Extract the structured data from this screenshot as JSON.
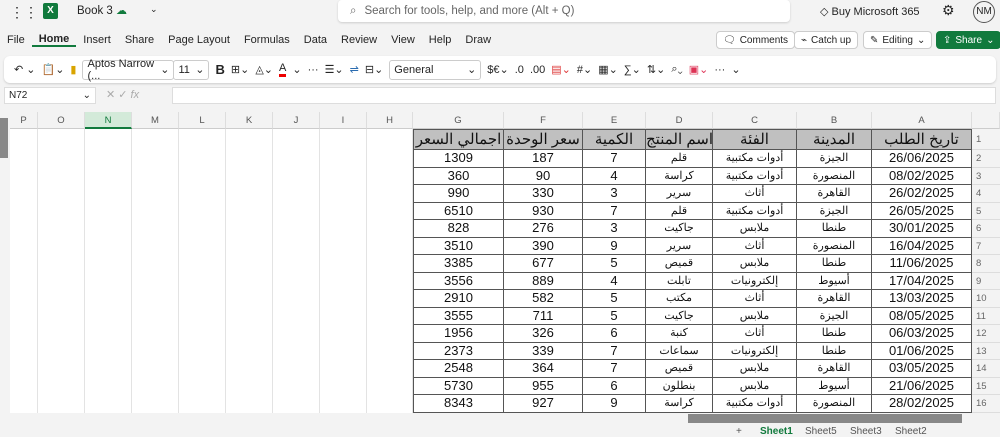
{
  "app": {
    "title": "Book 3",
    "search_placeholder": "Search for tools, help, and more (Alt + Q)",
    "buy": "Buy Microsoft 365",
    "avatar": "NM"
  },
  "menu": [
    "File",
    "Home",
    "Insert",
    "Share",
    "Page Layout",
    "Formulas",
    "Data",
    "Review",
    "View",
    "Help",
    "Draw"
  ],
  "ribbon_buttons": {
    "comments": "Comments",
    "catchup": "Catch up",
    "editing": "Editing",
    "share": "Share"
  },
  "toolbar": {
    "font": "Aptos Narrow (...",
    "size": "11",
    "format": "General",
    "bold": "B"
  },
  "namebox": "N72",
  "columns": [
    "P",
    "O",
    "N",
    "M",
    "L",
    "K",
    "J",
    "I",
    "H",
    "G",
    "F",
    "E",
    "D",
    "C",
    "B",
    "A"
  ],
  "selected_column": "N",
  "table": {
    "headers": [
      "تاريخ الطلب",
      "المدينة",
      "الفئة",
      "اسم المنتج",
      "الكمية",
      "سعر الوحدة",
      "اجمالي السعر"
    ],
    "rows": [
      [
        "26/06/2025",
        "الجيزة",
        "أدوات مكتبية",
        "قلم",
        "7",
        "187",
        "1309"
      ],
      [
        "08/02/2025",
        "المنصورة",
        "أدوات مكتبية",
        "كراسة",
        "4",
        "90",
        "360"
      ],
      [
        "26/02/2025",
        "القاهرة",
        "أثاث",
        "سرير",
        "3",
        "330",
        "990"
      ],
      [
        "26/05/2025",
        "الجيزة",
        "أدوات مكتبية",
        "قلم",
        "7",
        "930",
        "6510"
      ],
      [
        "30/01/2025",
        "طنطا",
        "ملابس",
        "جاكيت",
        "3",
        "276",
        "828"
      ],
      [
        "16/04/2025",
        "المنصورة",
        "أثاث",
        "سرير",
        "9",
        "390",
        "3510"
      ],
      [
        "11/06/2025",
        "طنطا",
        "ملابس",
        "قميص",
        "5",
        "677",
        "3385"
      ],
      [
        "17/04/2025",
        "أسيوط",
        "إلكترونيات",
        "تابلت",
        "4",
        "889",
        "3556"
      ],
      [
        "13/03/2025",
        "القاهرة",
        "أثاث",
        "مكتب",
        "5",
        "582",
        "2910"
      ],
      [
        "08/05/2025",
        "الجيزة",
        "ملابس",
        "جاكيت",
        "5",
        "711",
        "3555"
      ],
      [
        "06/03/2025",
        "طنطا",
        "أثاث",
        "كنبة",
        "6",
        "326",
        "1956"
      ],
      [
        "01/06/2025",
        "طنطا",
        "إلكترونيات",
        "سماعات",
        "7",
        "339",
        "2373"
      ],
      [
        "03/05/2025",
        "القاهرة",
        "ملابس",
        "قميص",
        "7",
        "364",
        "2548"
      ],
      [
        "21/06/2025",
        "أسيوط",
        "ملابس",
        "بنطلون",
        "6",
        "955",
        "5730"
      ],
      [
        "28/02/2025",
        "المنصورة",
        "أدوات مكتبية",
        "كراسة",
        "9",
        "927",
        "8343"
      ]
    ]
  },
  "sheets": [
    "Sheet1",
    "Sheet5",
    "Sheet3",
    "Sheet2"
  ],
  "add_sheet": "+"
}
